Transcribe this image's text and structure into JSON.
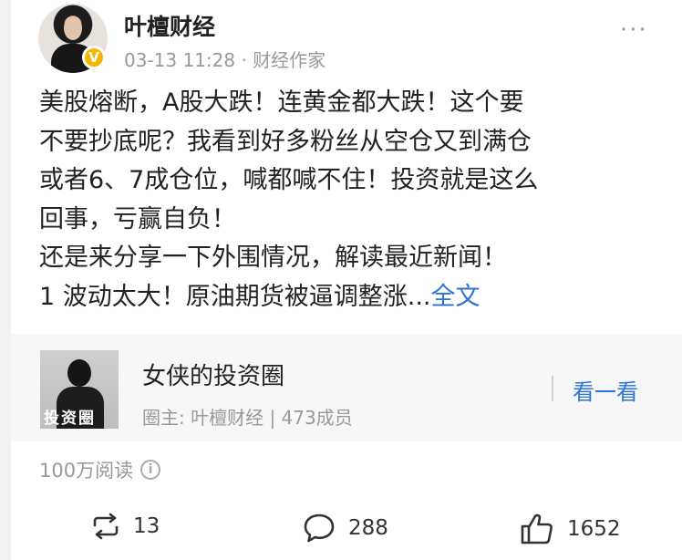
{
  "post": {
    "author": "叶檀财经",
    "timestamp": "03-13 11:28",
    "meta_sep": " · ",
    "source": "财经作家",
    "content": "美股熔断，A股大跌！连黄金都大跌！这个要\n不要抄底呢？我看到好多粉丝从空仓又到满仓\n或者6、7成仓位，喊都喊不住！投资就是这么\n回事，亏赢自负！\n还是来分享一下外围情况，解读最近新闻！\n1 波动太大！原油期货被逼调整涨...",
    "full_text_link": "全文",
    "more_icon": "···",
    "verified_badge": "V"
  },
  "circle": {
    "name": "女侠的投资圈",
    "owner_label": "圈主: 叶檀财经 | 473成员",
    "action_label": "看一看",
    "thumb_stamp": "投资圈"
  },
  "reads": {
    "label": "100万阅读",
    "info_icon": "i"
  },
  "actions": {
    "repost_count": "13",
    "comment_count": "288",
    "like_count": "1652"
  },
  "colors": {
    "link": "#2a73d9",
    "verified": "#f7b500",
    "muted": "#999999"
  }
}
